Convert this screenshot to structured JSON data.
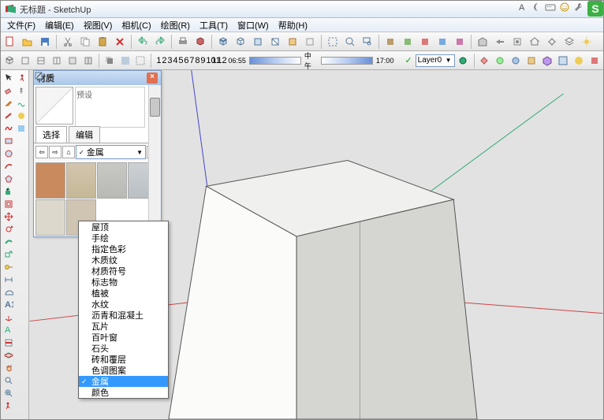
{
  "title": "无标题 - SketchUp",
  "menu": [
    "文件(F)",
    "编辑(E)",
    "视图(V)",
    "相机(C)",
    "绘图(R)",
    "工具(T)",
    "窗口(W)",
    "帮助(H)"
  ],
  "ruler": [
    "1",
    "2",
    "3",
    "4",
    "5",
    "6",
    "7",
    "8",
    "9",
    "10",
    "11",
    "12"
  ],
  "timeline": {
    "start": "06:55",
    "mid": "中午",
    "end": "17:00"
  },
  "layer": {
    "label": "Layer0",
    "check": "✓"
  },
  "panel": {
    "title": "材质",
    "preset": "预设",
    "tabs": [
      "选择",
      "编辑"
    ],
    "combo": "金属"
  },
  "dropdown": [
    "屋顶",
    "手绘",
    "指定色彩",
    "木质纹",
    "材质符号",
    "标志物",
    "植被",
    "水纹",
    "沥青和混凝土",
    "瓦片",
    "百叶窗",
    "石头",
    "砖和覆层",
    "色调图案",
    "金属",
    "颜色"
  ],
  "selected": "金属",
  "swatchColors": [
    "#c98a5e",
    "#cbb89d",
    "#b9b6b3",
    "#bfc3c7",
    "#d4d4d0",
    "#c6b7a6"
  ],
  "greenS": "S"
}
